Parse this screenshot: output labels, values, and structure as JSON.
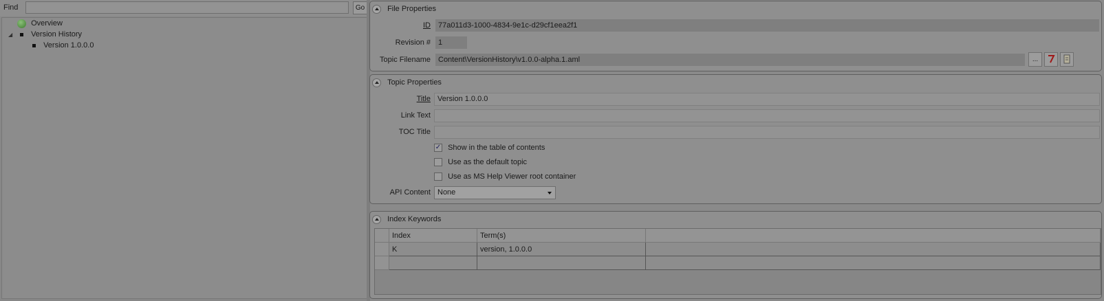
{
  "find_bar": {
    "label": "Find",
    "value": "",
    "go_label": "Go"
  },
  "tree": {
    "overview": "Overview",
    "version_history": "Version History",
    "version_item": "Version 1.0.0.0"
  },
  "file_properties": {
    "title": "File Properties",
    "id_label": "ID",
    "id_value": "77a011d3-1000-4834-9e1c-d29cf1eea2f1",
    "revision_label": "Revision #",
    "revision_value": "1",
    "filename_label": "Topic Filename",
    "filename_value": "Content\\VersionHistory\\v1.0.0-alpha.1.aml",
    "browse_label": "...",
    "icons": [
      "ellipsis-icon",
      "edit-icon",
      "file-icon"
    ]
  },
  "topic_properties": {
    "title": "Topic Properties",
    "title_label": "Title",
    "title_value": "Version 1.0.0.0",
    "link_text_label": "Link Text",
    "link_text_value": "",
    "toc_title_label": "TOC Title",
    "toc_title_value": "",
    "checkboxes": [
      {
        "label": "Show in the table of contents",
        "checked": true
      },
      {
        "label": "Use as the default topic",
        "checked": false
      },
      {
        "label": "Use as MS Help Viewer root container",
        "checked": false
      }
    ],
    "api_content_label": "API Content",
    "api_content_value": "None"
  },
  "index_keywords": {
    "title": "Index Keywords",
    "columns": [
      "Index",
      "Term(s)"
    ],
    "rows": [
      [
        "K",
        "version, 1.0.0.0"
      ],
      [
        "",
        ""
      ]
    ]
  },
  "colors": {
    "overlay_gray": "#8a8a8a",
    "check_mark": "#1b1b5a",
    "edit_icon_red": "#a01818"
  }
}
